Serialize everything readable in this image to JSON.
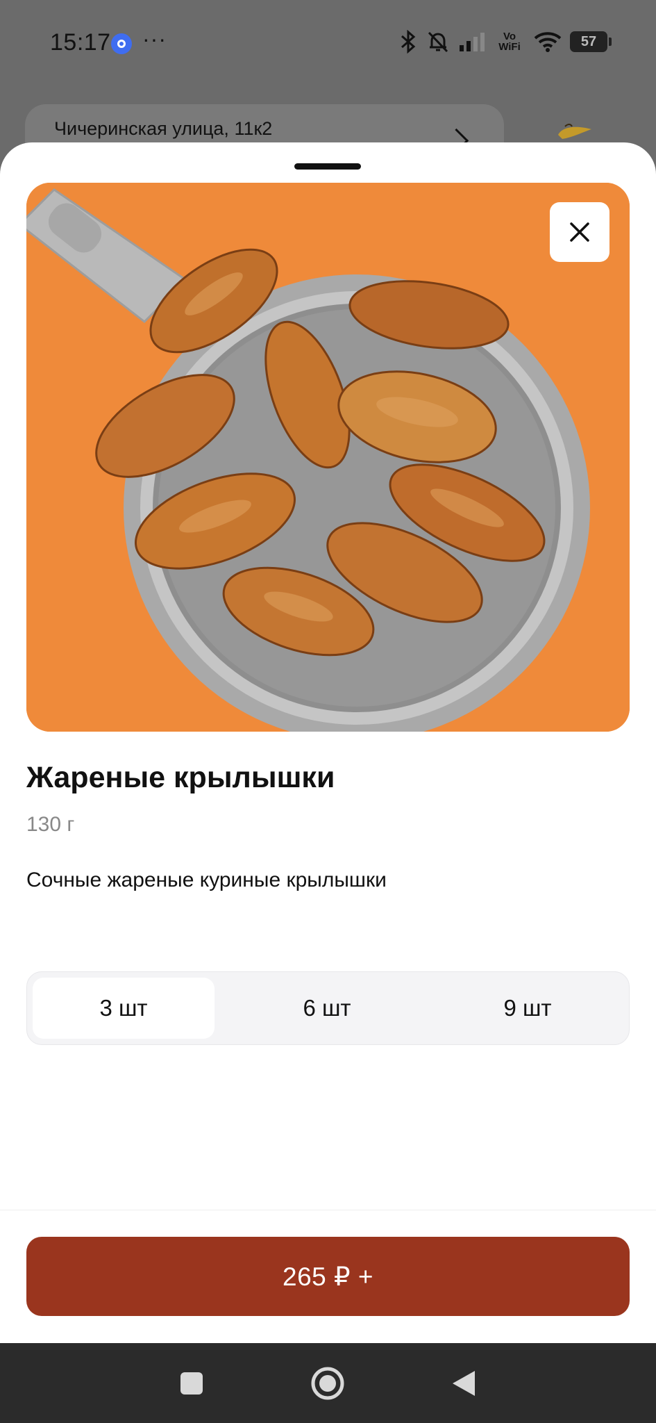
{
  "status_bar": {
    "time": "15:17",
    "more": "···",
    "vowifi_line1": "Vo",
    "vowifi_line2": "WiFi",
    "battery": "57",
    "icons": [
      "app-notification-icon",
      "bluetooth-icon",
      "bell-muted-icon",
      "cellular-signal-icon",
      "wifi-icon",
      "battery-icon"
    ]
  },
  "background": {
    "address": "Чичеринская улица, 11к2"
  },
  "product": {
    "title": "Жареные крылышки",
    "weight": "130 г",
    "description": "Сочные жареные куриные крылышки",
    "image": "fried-chicken-wings-in-pan"
  },
  "size_options": [
    {
      "label": "3 шт",
      "selected": true
    },
    {
      "label": "6 шт",
      "selected": false
    },
    {
      "label": "9 шт",
      "selected": false
    }
  ],
  "add_button": {
    "label": "265 ₽ +"
  },
  "colors": {
    "accent": "#9a351e",
    "image_background": "#ef8a3a"
  },
  "nav_bar": {
    "icons": [
      "recent-apps-icon",
      "home-icon",
      "back-icon"
    ]
  }
}
